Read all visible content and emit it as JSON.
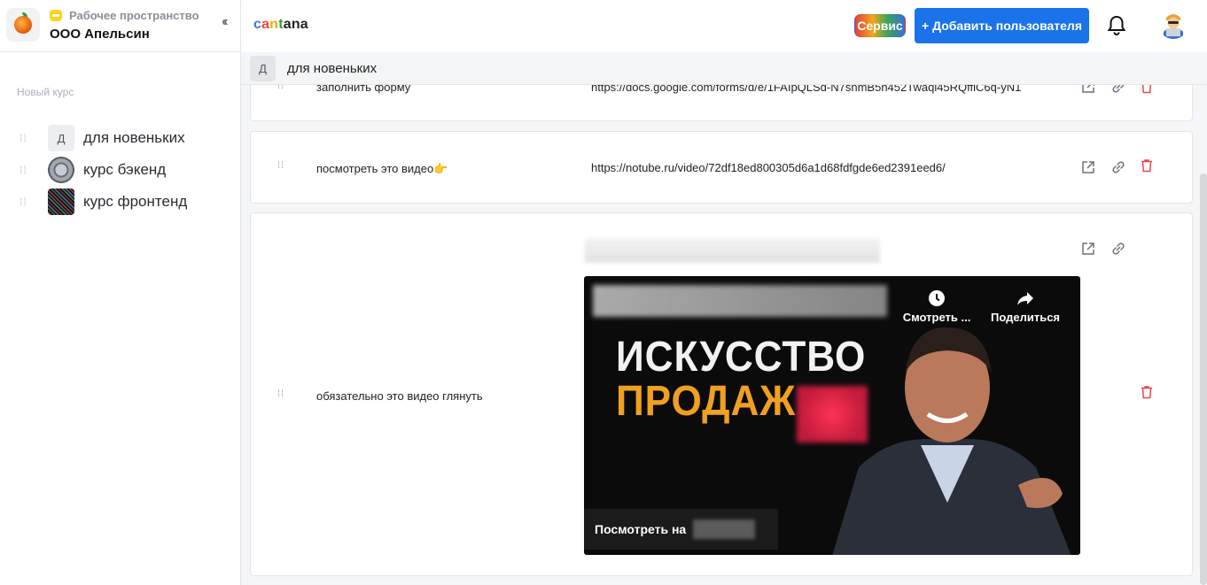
{
  "workspace": {
    "label": "Рабочее пространство",
    "name": "ООО Апельсин"
  },
  "sidebar": {
    "new_course": "Новый курс",
    "courses": [
      {
        "thumb_letter": "Д",
        "label": "для новеньких"
      },
      {
        "thumb_letter": "",
        "label": "курс бэкенд"
      },
      {
        "thumb_letter": "",
        "label": "курс фронтенд"
      }
    ]
  },
  "header": {
    "brand": [
      "c",
      "a",
      "n",
      "t",
      "ana"
    ],
    "service_label": "Сервис",
    "add_user_label": "+ Добавить пользователя"
  },
  "course": {
    "thumb_letter": "Д",
    "title": "для новеньких"
  },
  "lessons": [
    {
      "title": "заполнить форму",
      "url": "https://docs.google.com/forms/d/e/1FAIpQLSd-N7shmB5n452Twaqi45RQffiC6q-yN1"
    },
    {
      "title": "посмотреть это видео👉",
      "url": "https://notube.ru/video/72df18ed800305d6a1d68fdfgde6ed2391eed6/"
    },
    {
      "title": "обязательно это видео глянуть",
      "url": ""
    }
  ],
  "video": {
    "headline_1": "ИСКУССТВО",
    "headline_2": "ПРОДАЖ",
    "watch_later": "Смотреть ...",
    "share": "Поделиться",
    "watch_on": "Посмотреть на"
  },
  "colors": {
    "primary": "#1a73e8",
    "danger": "#e5484d"
  }
}
